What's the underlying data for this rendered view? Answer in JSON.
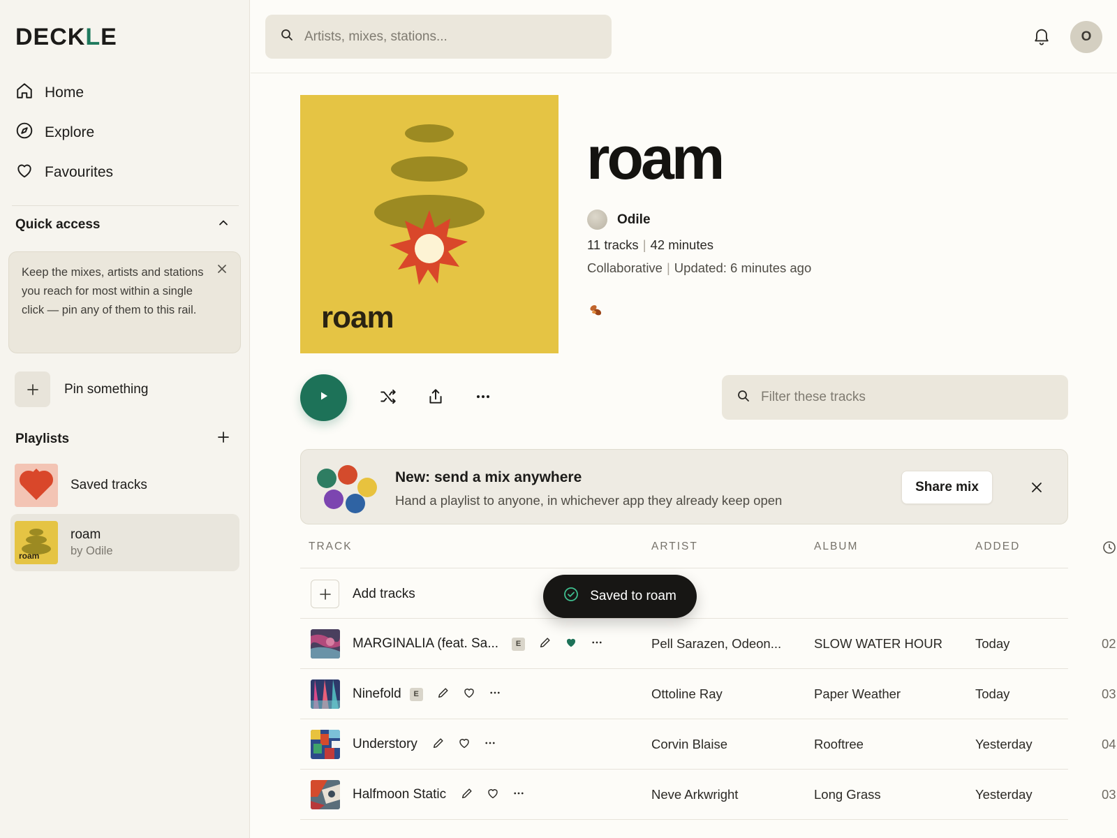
{
  "app": {
    "logo_pre": "DECK",
    "logo_accent": "L",
    "logo_post": "E"
  },
  "sidebar": {
    "nav": [
      {
        "label": "Home",
        "icon": "home-icon"
      },
      {
        "label": "Explore",
        "icon": "compass-icon"
      },
      {
        "label": "Favourites",
        "icon": "heart-icon"
      }
    ],
    "quick_access": {
      "title": "Quick access",
      "tip": "Keep the mixes, artists and stations you reach for most within a single click — pin any of them to this rail.",
      "pin_label": "Pin something"
    },
    "playlists": {
      "title": "Playlists",
      "items": [
        {
          "title": "Saved tracks",
          "subtitle": ""
        },
        {
          "title": "roam",
          "subtitle": "by Odile",
          "thumb_text": "roam"
        }
      ]
    }
  },
  "topbar": {
    "search_placeholder": "Artists, mixes, stations...",
    "avatar_initial": "O"
  },
  "playlist": {
    "cover_text": "roam",
    "title": "roam",
    "owner": "Odile",
    "tracks_count": "11 tracks",
    "duration": "42 minutes",
    "type": "Collaborative",
    "updated": "Updated: 6 minutes ago"
  },
  "controls": {
    "filter_placeholder": "Filter these tracks"
  },
  "banner": {
    "title": "New: send a mix anywhere",
    "subtitle": "Hand a playlist to anyone, in whichever app they already keep open",
    "button": "Share mix"
  },
  "table": {
    "headers": {
      "track": "TRACK",
      "artist": "ARTIST",
      "album": "ALBUM",
      "added": "ADDED"
    },
    "add_tracks": "Add tracks",
    "rows": [
      {
        "title": "MARGINALIA (feat. Sa...",
        "explicit": "E",
        "artist": "Pell Sarazen, Odeon...",
        "album": "SLOW WATER HOUR",
        "added": "Today",
        "duration": "02",
        "liked": true
      },
      {
        "title": "Ninefold",
        "explicit": "E",
        "artist": "Ottoline Ray",
        "album": "Paper Weather",
        "added": "Today",
        "duration": "03",
        "liked": false
      },
      {
        "title": "Understory",
        "explicit": "",
        "artist": "Corvin Blaise",
        "album": "Rooftree",
        "added": "Yesterday",
        "duration": "04",
        "liked": false
      },
      {
        "title": "Halfmoon Static",
        "explicit": "",
        "artist": "Neve Arkwright",
        "album": "Long Grass",
        "added": "Yesterday",
        "duration": "03",
        "liked": false
      }
    ]
  },
  "toast": {
    "message": "Saved to roam"
  },
  "colors": {
    "accent": "#1d7258",
    "cover": "#e5c444",
    "background": "#fdfcf8",
    "sidebar": "#f6f4ee"
  }
}
